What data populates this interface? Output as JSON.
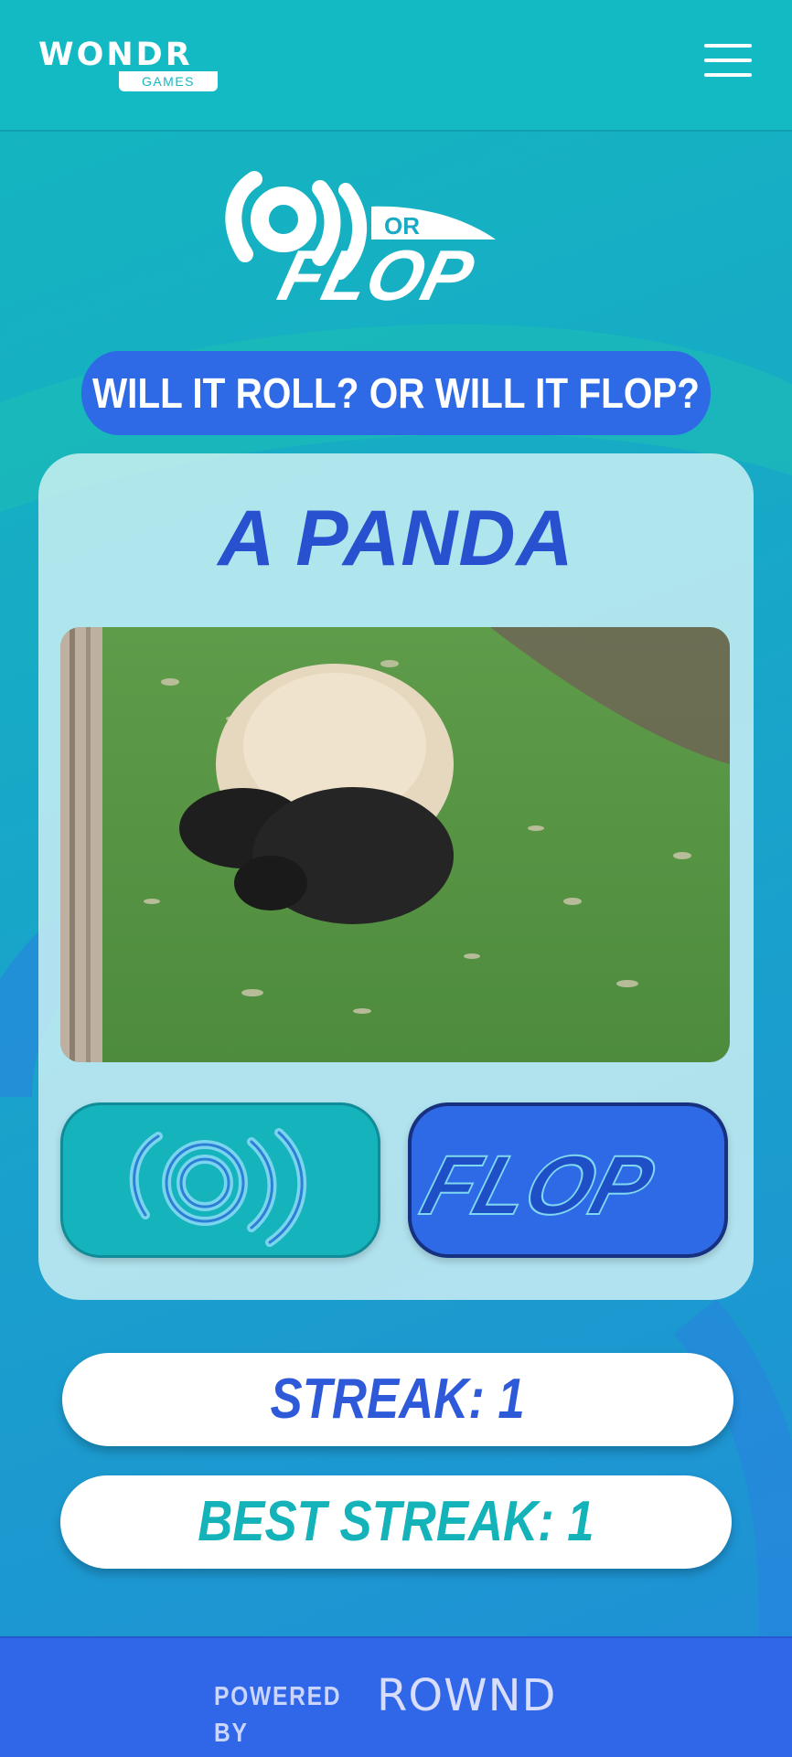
{
  "brand": {
    "name": "WONDR",
    "sub": "GAMES"
  },
  "logo": {
    "roll_text": "ROLL",
    "or_text": "OR",
    "flop_text": "FLOP"
  },
  "tagline": "WILL IT ROLL? OR WILL IT FLOP?",
  "card": {
    "title": "A PANDA"
  },
  "buttons": {
    "roll": "ROLL",
    "flop": "FLOP"
  },
  "stats": {
    "streak": "STREAK: 1",
    "best_streak": "BEST STREAK: 1"
  },
  "footer": {
    "powered_by": "POWERED BY",
    "partner": "ROWND"
  },
  "colors": {
    "teal": "#13b9c3",
    "blue": "#2f6ae6",
    "title_blue": "#2851cf"
  },
  "icons": {
    "menu": "hamburger-menu-icon"
  }
}
